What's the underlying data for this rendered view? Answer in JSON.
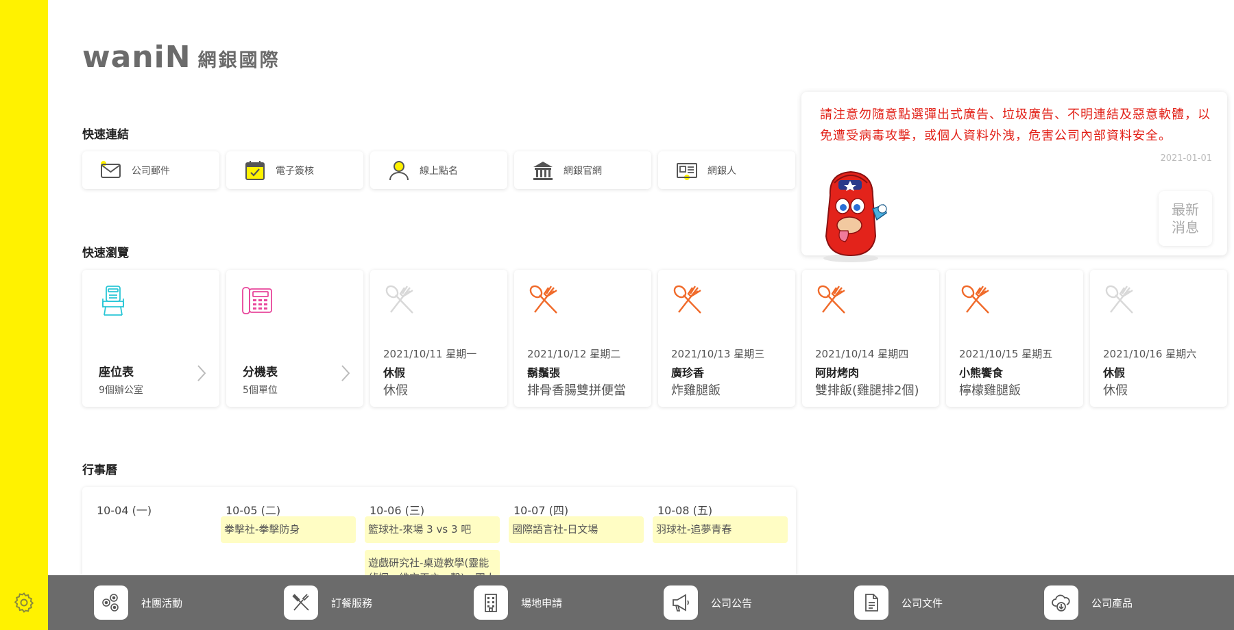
{
  "colors": {
    "sidebar": "#fff200",
    "bottombar": "#6b6b6b",
    "notice_text": "#e2231a",
    "event_bg": "#fffdc4",
    "food_active": "#f06a2a",
    "food_inactive": "#d8d8d8"
  },
  "logo": {
    "word": "waniN",
    "cn": "網銀國際"
  },
  "quick_links": {
    "title": "快速連結",
    "items": [
      {
        "label": "公司郵件",
        "icon": "mail-icon"
      },
      {
        "label": "電子簽核",
        "icon": "calendar-check-icon"
      },
      {
        "label": "線上點名",
        "icon": "user-icon"
      },
      {
        "label": "網銀官網",
        "icon": "bank-icon"
      },
      {
        "label": "網銀人",
        "icon": "newspaper-icon"
      }
    ]
  },
  "browse": {
    "title": "快速瀏覽",
    "seat": {
      "title": "座位表",
      "sub": "9個辦公室",
      "icon": "seat-icon"
    },
    "ext": {
      "title": "分機表",
      "sub": "5個單位",
      "icon": "phone-icon"
    },
    "meals": [
      {
        "date": "2021/10/11 星期一",
        "shop": "休假",
        "meal": "休假",
        "active": false
      },
      {
        "date": "2021/10/12 星期二",
        "shop": "鬍鬚張",
        "meal": "排骨香腸雙拼便當",
        "active": true
      },
      {
        "date": "2021/10/13 星期三",
        "shop": "廣珍香",
        "meal": "炸雞腿飯",
        "active": true
      },
      {
        "date": "2021/10/14 星期四",
        "shop": "阿財烤肉",
        "meal": "雙排飯(雞腿排2個)",
        "active": true
      },
      {
        "date": "2021/10/15 星期五",
        "shop": "小熊饗食",
        "meal": "檸檬雞腿飯",
        "active": true
      },
      {
        "date": "2021/10/16 星期六",
        "shop": "休假",
        "meal": "休假",
        "active": false
      }
    ]
  },
  "notice": {
    "text": "請注意勿隨意點選彈出式廣告、垃圾廣告、不明連結及惡意軟體，以免遭受病毒攻擊，或個人資料外洩，危害公司內部資料安全。",
    "date": "2021-01-01",
    "news_line1": "最新",
    "news_line2": "消息"
  },
  "calendar": {
    "title": "行事曆",
    "days": [
      {
        "header": "10-04 (一)",
        "events": []
      },
      {
        "header": "10-05 (二)",
        "events": [
          "拳擊社-拳擊防身"
        ]
      },
      {
        "header": "10-06 (三)",
        "events": [
          "籃球社-來場 3 vs 3 吧",
          "遊戲研究社-桌遊教學(靈能偵探、維京王之一擊)、團人Pub"
        ]
      },
      {
        "header": "10-07 (四)",
        "events": [
          "國際語言社-日文場"
        ]
      },
      {
        "header": "10-08 (五)",
        "events": [
          "羽球社-追夢青春"
        ]
      }
    ]
  },
  "bottombar": {
    "items": [
      {
        "label": "社團活動",
        "icon": "club-icon"
      },
      {
        "label": "訂餐服務",
        "icon": "utensils-icon"
      },
      {
        "label": "場地申請",
        "icon": "building-icon"
      },
      {
        "label": "公司公告",
        "icon": "megaphone-icon"
      },
      {
        "label": "公司文件",
        "icon": "document-icon"
      },
      {
        "label": "公司產品",
        "icon": "cloud-download-icon"
      }
    ]
  },
  "settings": {
    "icon": "gear-icon"
  }
}
